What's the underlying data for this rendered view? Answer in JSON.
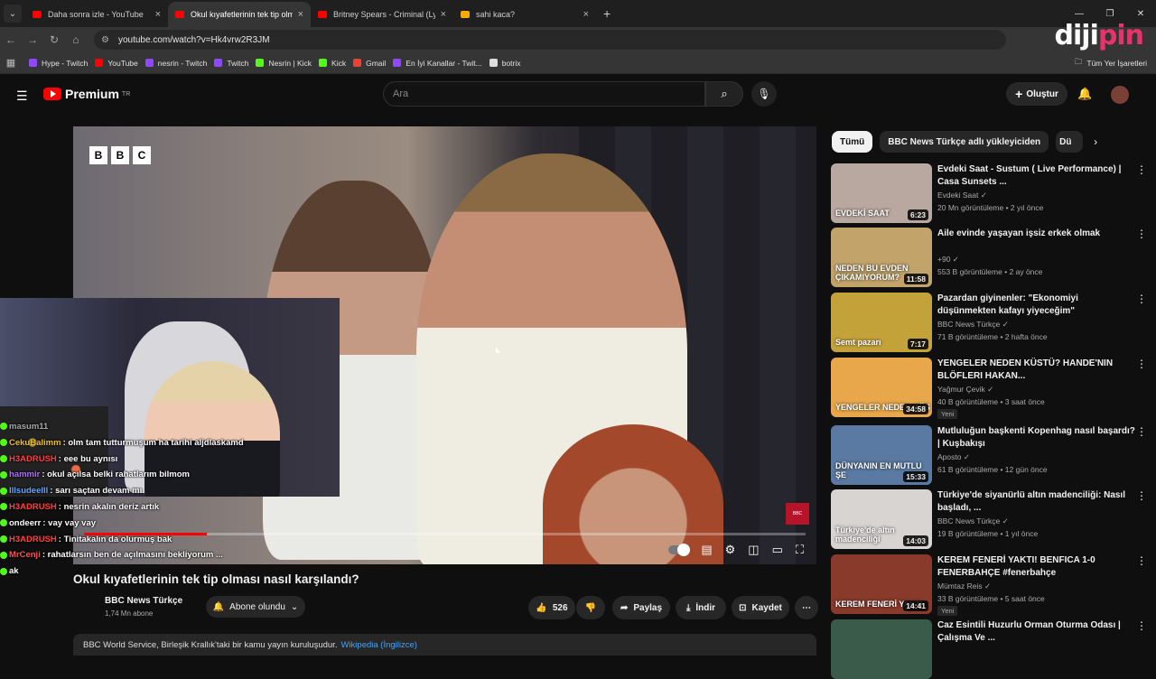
{
  "browser": {
    "tabs": [
      {
        "title": "Daha sonra izle - YouTube",
        "color": "#ff0000"
      },
      {
        "title": "Okul kıyafetlerinin tek tip olması",
        "color": "#ff0000"
      },
      {
        "title": "Britney Spears - Criminal (Lyrics)",
        "color": "#ff0000"
      },
      {
        "title": "sahi kaca?",
        "color": "#f9ab00"
      }
    ],
    "url": "youtube.com/watch?v=Hk4vrw2R3JM",
    "logo_a": "diji",
    "logo_b": "pin",
    "bookmarks": [
      {
        "label": "Hype - Twitch",
        "color": "#9146ff"
      },
      {
        "label": "YouTube",
        "color": "#ff0000"
      },
      {
        "label": "nesrin - Twitch",
        "color": "#9146ff"
      },
      {
        "label": "Twitch",
        "color": "#9146ff"
      },
      {
        "label": "Nesrin | Kick",
        "color": "#53fc18"
      },
      {
        "label": "Kick",
        "color": "#53fc18"
      },
      {
        "label": "Gmail",
        "color": "#ea4335"
      },
      {
        "label": "En İyi Kanallar - Twit...",
        "color": "#9146ff"
      },
      {
        "label": "botrix",
        "color": "#dddddd"
      }
    ],
    "all_bookmarks": "Tüm Yer İşaretleri"
  },
  "youtube": {
    "logo": "Premium",
    "region": "TR",
    "search_placeholder": "Ara",
    "create_label": "Oluştur",
    "video": {
      "title": "Okul kıyafetlerinin tek tip olması nasıl karşılandı?",
      "channel": "BBC News Türkçe",
      "subscribers": "1,74 Mn abone",
      "subscribe_label": "Abone olundu",
      "likes": "526",
      "share": "Paylaş",
      "download": "İndir",
      "save": "Kaydet",
      "description": "BBC World Service, Birleşik Krallık'taki bir kamu yayın kuruluşudur.",
      "wiki": "Wikipedia (İngilizce)",
      "progress_fraction": 0.17
    },
    "chips": [
      "Tümü",
      "BBC News Türkçe adlı yükleyiciden",
      "Dü"
    ],
    "recommendations": [
      {
        "title": "Evdeki Saat - Sustum ( Live Performance) | Casa Sunsets ...",
        "channel": "Evdeki Saat",
        "meta": "20 Mn görüntüleme • 2 yıl önce",
        "duration": "6:23",
        "thumb_text": "EVDEKİ SAAT",
        "bg": "#b9a8a0",
        "badge": ""
      },
      {
        "title": "Aile evinde yaşayan işsiz erkek olmak",
        "channel": "+90",
        "meta": "553 B görüntüleme • 2 ay önce",
        "duration": "11:58",
        "thumb_text": "NEDEN BU EVDEN ÇIKAMIYORUM?",
        "bg": "#c2a46a",
        "badge": ""
      },
      {
        "title": "Pazardan giyinenler: \"Ekonomiyi düşünmekten kafayı yiyeceğim\"",
        "channel": "BBC News Türkçe",
        "meta": "71 B görüntüleme • 2 hafta önce",
        "duration": "7:17",
        "thumb_text": "Semt pazarı",
        "bg": "#c4a23a",
        "badge": ""
      },
      {
        "title": "YENGELER NEDEN KÜSTÜ? HANDE'NIN BLÖFLERI HAKAN...",
        "channel": "Yağmur Çevik",
        "meta": "40 B görüntüleme • 3 saat önce",
        "duration": "34:58",
        "thumb_text": "YENGELER NEDEN KÜS",
        "bg": "#e8a74a",
        "badge": "Yeni"
      },
      {
        "title": "Mutluluğun başkenti Kopenhag nasıl başardı? | Kuşbakışı",
        "channel": "Aposto",
        "meta": "61 B görüntüleme • 12 gün önce",
        "duration": "15:33",
        "thumb_text": "DÜNYANIN EN MUTLU ŞE",
        "bg": "#5a7aa4",
        "badge": ""
      },
      {
        "title": "Türkiye'de siyanürlü altın madenciliği: Nasıl başladı, ...",
        "channel": "BBC News Türkçe",
        "meta": "19 B görüntüleme • 1 yıl önce",
        "duration": "14:03",
        "thumb_text": "Türkiye'de altın madenciliği",
        "bg": "#d8d4d2",
        "badge": ""
      },
      {
        "title": "KEREM FENERİ YAKTI! BENFICA 1-0 FENERBAHÇE #fenerbahçe",
        "channel": "Mümtaz Reis",
        "meta": "33 B görüntüleme • 5 saat önce",
        "duration": "14:41",
        "thumb_text": "KEREM FENERİ YAKTI",
        "bg": "#8a3a2a",
        "badge": "Yeni"
      },
      {
        "title": "Caz Esintili Huzurlu Orman Oturma Odası | Çalışma Ve ...",
        "channel": "",
        "meta": "",
        "duration": "",
        "thumb_text": "",
        "bg": "#3a5a4a",
        "badge": ""
      }
    ]
  },
  "chat": [
    {
      "user": "masum11",
      "msg": "",
      "color": "#aaaaaa"
    },
    {
      "user": "CekuBalimm",
      "msg": "olm tam tutturmuşum ha tarihi aljdlaskamd",
      "color": "#f0c020"
    },
    {
      "user": "H3ADRUSH",
      "msg": "eee bu aynısı",
      "color": "#ff4040"
    },
    {
      "user": "hammir",
      "msg": "okul açılsa belki rahatlarım bilmom",
      "color": "#b070ff"
    },
    {
      "user": "Illsudeelll",
      "msg": "sarı saçtan devam mı",
      "color": "#6aa8ff"
    },
    {
      "user": "H3ADRUSH",
      "msg": "nesrin akalın deriz artık",
      "color": "#ff4040"
    },
    {
      "user": "ondeerr",
      "msg": "vay vay vay",
      "color": "#ffffff"
    },
    {
      "user": "H3ADRUSH",
      "msg": "Tinitakalın da olurmuş bak",
      "color": "#ff4040"
    },
    {
      "user": "MrCenji",
      "msg": "rahatlarsın ben de açılmasını bekliyorum ...",
      "color": "#ff5050"
    },
    {
      "user": "ak",
      "msg": "",
      "color": "#ffffff"
    }
  ]
}
